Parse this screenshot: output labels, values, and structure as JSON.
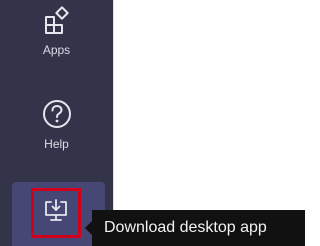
{
  "rail": {
    "apps": {
      "label": "Apps",
      "icon": "apps-icon"
    },
    "help": {
      "label": "Help",
      "icon": "help-icon"
    },
    "download": {
      "icon": "download-desktop-icon",
      "highlight_color": "#d0021b"
    }
  },
  "tooltip": {
    "text": "Download desktop app"
  },
  "colors": {
    "rail_bg": "#33344a",
    "active_bg": "#464775",
    "tooltip_bg": "#111111",
    "content_bg": "#ffffff"
  }
}
